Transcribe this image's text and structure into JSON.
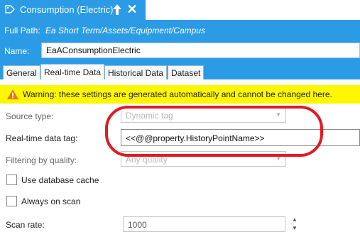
{
  "window": {
    "title": "Consumption (Electric)",
    "icon": "tag-icon",
    "pin_icon": "pin-icon",
    "close_glyph": "✕"
  },
  "path": {
    "label": "Full Path:",
    "value": "Ea Short Term/Assets/Equipment/Campus"
  },
  "name": {
    "label": "Name:",
    "value": "EaAConsumptionElectric"
  },
  "tabs": [
    {
      "label": "General",
      "active": false
    },
    {
      "label": "Real-time Data",
      "active": true
    },
    {
      "label": "Historical Data",
      "active": false
    },
    {
      "label": "Dataset",
      "active": false
    }
  ],
  "warning": {
    "icon": "warning-icon",
    "text": "Warning: these settings are generated automatically and cannot be changed here."
  },
  "fields": {
    "source_type": {
      "label": "Source type:",
      "value": "Dynamic tag"
    },
    "realtime_tag": {
      "label": "Real-time data tag:",
      "value": "<<@@property.HistoryPointName>>"
    },
    "filtering": {
      "label": "Filtering by quality:",
      "value": "Any quality"
    },
    "use_cache": {
      "label": "Use database cache",
      "checked": false
    },
    "always_on_scan": {
      "label": "Always on scan",
      "checked": false
    },
    "scan_rate": {
      "label": "Scan rate:",
      "value": "1000"
    }
  },
  "colors": {
    "accent": "#2b9be6",
    "warning_bg": "#fff700",
    "highlight": "#e01b24"
  }
}
